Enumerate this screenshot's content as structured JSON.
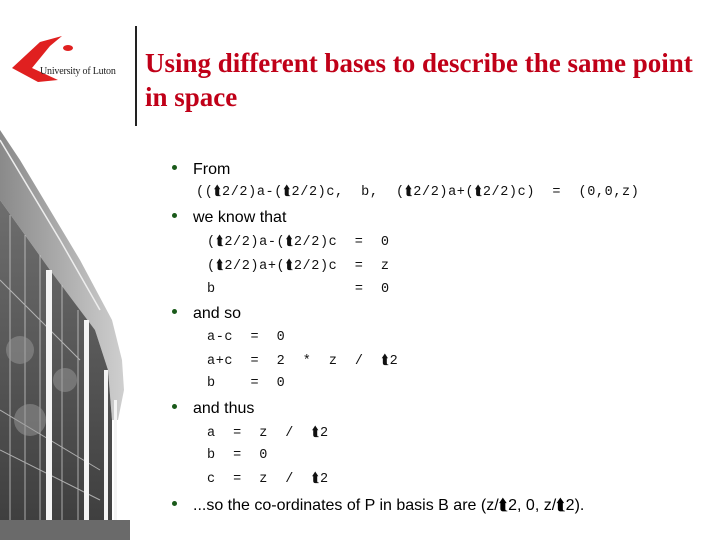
{
  "header": {
    "logo_text": "University of Luton",
    "title": "Using different bases to describe the same point in space",
    "title_color": "#c00018"
  },
  "symbols": {
    "sqrt_glyph": "⮬"
  },
  "sections": [
    {
      "bullet": "From",
      "lines": [
        "((⮬2/2)a-(⮬2/2)c,  b,  (⮬2/2)a+(⮬2/2)c)  =  (0,0,z)"
      ]
    },
    {
      "bullet": "we know that",
      "lines": [
        "(⮬2/2)a-(⮬2/2)c  =  0",
        "(⮬2/2)a+(⮬2/2)c  =  z",
        "b                =  0"
      ]
    },
    {
      "bullet": "and so",
      "lines": [
        "a-c  =  0",
        "a+c  =  2  *  z  /  ⮬2",
        "b    =  0"
      ]
    },
    {
      "bullet": "and thus",
      "lines": [
        "a  =  z  /  ⮬2",
        "b  =  0",
        "c  =  z  /  ⮬2"
      ]
    },
    {
      "bullet": "...so the co-ordinates of P in basis B are (z/⮬2, 0, z/⮬2).",
      "lines": []
    }
  ],
  "colors": {
    "bullet": "#1a5a1a",
    "divider": "#222222"
  }
}
